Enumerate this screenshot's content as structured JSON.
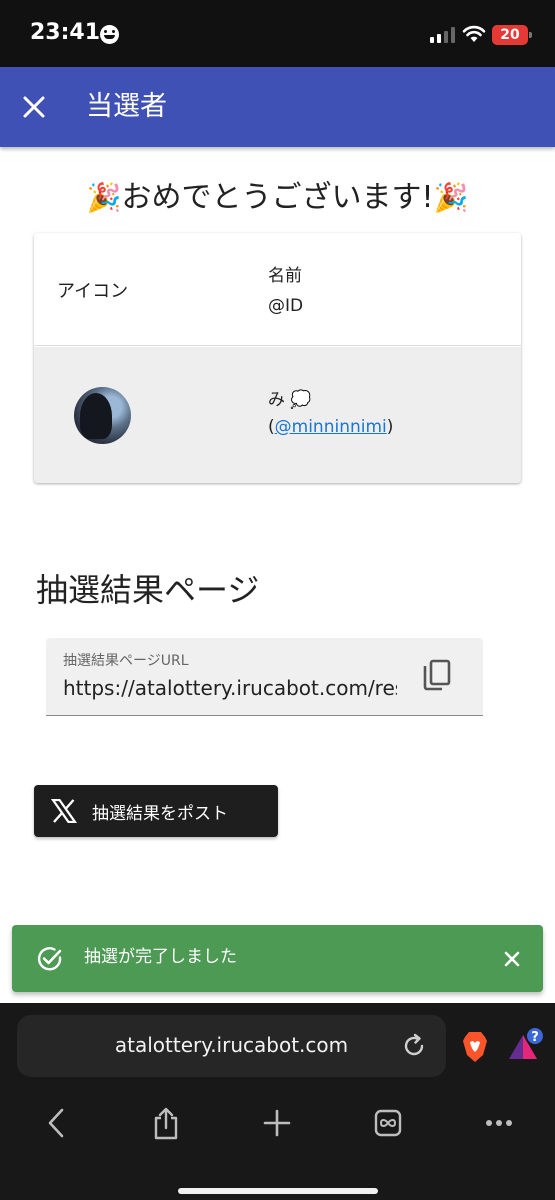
{
  "status_bar": {
    "time": "23:41",
    "battery": "20"
  },
  "app_bar": {
    "title": "当選者",
    "close_icon": "close-icon"
  },
  "congrats": {
    "text": "おめでとうございます!",
    "party_emoji": "🎉"
  },
  "winners_table": {
    "header": {
      "icon_label": "アイコン",
      "name_label": "名前",
      "id_label": "@ID"
    },
    "rows": [
      {
        "name": "み 💭",
        "id_prefix": "(",
        "id": "@minninnimi",
        "id_suffix": ")"
      }
    ]
  },
  "result_page": {
    "section_title": "抽選結果ページ",
    "url_label": "抽選結果ページURL",
    "url_value": "https://atalottery.irucabot.com/result"
  },
  "post_button": {
    "label": "抽選結果をポスト"
  },
  "snackbar": {
    "message": "抽選が完了しました"
  },
  "browser": {
    "address": "atalottery.irucabot.com",
    "rewards_badge": "?"
  },
  "colors": {
    "app_bar": "#3f51b5",
    "snackbar": "#4d9a54",
    "link": "#1976d2",
    "post_button": "#1e1e1e"
  }
}
